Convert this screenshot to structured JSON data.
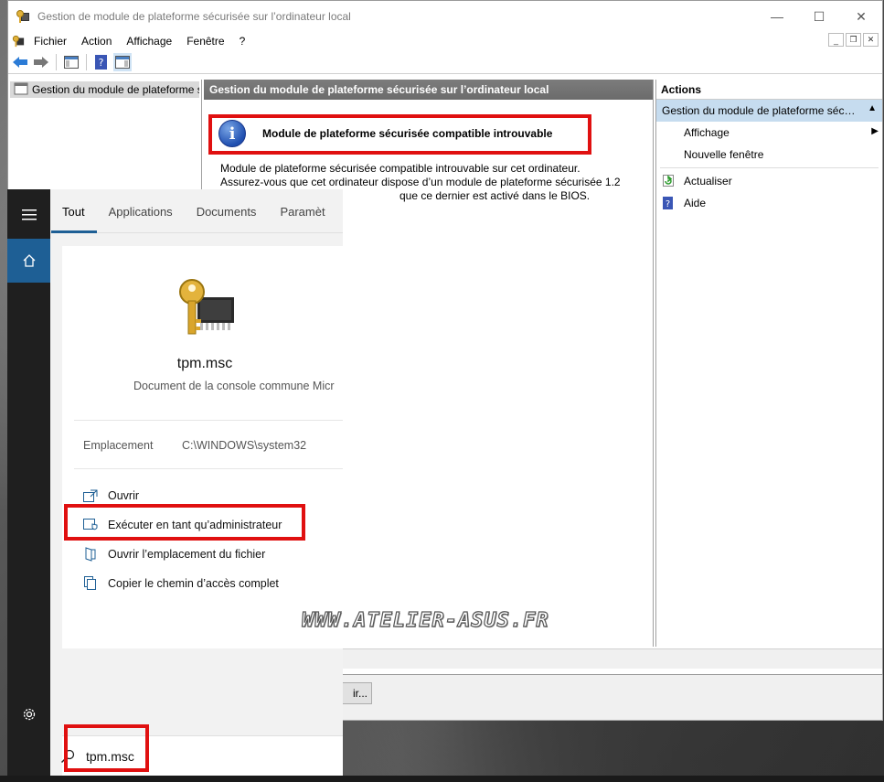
{
  "window": {
    "title": "Gestion de module de plateforme sécurisée sur l’ordinateur local",
    "controls": {
      "minimize": "—",
      "maximize": "☐",
      "close": "✕"
    }
  },
  "menu": {
    "items": [
      "Fichier",
      "Action",
      "Affichage",
      "Fenêtre",
      "?"
    ]
  },
  "tree": {
    "root_label": "Gestion du module de plateforme sécurisée"
  },
  "center": {
    "header": "Gestion du module de plateforme sécurisée sur l’ordinateur local",
    "tpm_heading": "Module de plateforme sécurisée compatible introuvable",
    "tpm_desc_line1": "Module de plateforme sécurisée compatible introuvable sur cet ordinateur.",
    "tpm_desc_line2": "Assurez-vous que cet ordinateur dispose d’un module de plateforme sécurisée 1.2",
    "tpm_desc_line3": "que ce dernier est activé dans le BIOS."
  },
  "actions": {
    "title": "Actions",
    "section": "Gestion du module de plateforme sécurisée",
    "items": [
      {
        "label": "Affichage",
        "icon": "none",
        "submenu": true
      },
      {
        "label": "Nouvelle fenêtre",
        "icon": "none",
        "submenu": false
      },
      {
        "label": "Actualiser",
        "icon": "refresh-icon",
        "submenu": false
      },
      {
        "label": "Aide",
        "icon": "help-icon",
        "submenu": false
      }
    ]
  },
  "dialog": {
    "button_label": "ir..."
  },
  "start": {
    "tabs": [
      "Tout",
      "Applications",
      "Documents",
      "Paramèt"
    ],
    "active_tab": "Tout",
    "result": {
      "name": "tpm.msc",
      "type": "Document de la console commune Micr",
      "location_label": "Emplacement",
      "location_value": "C:\\WINDOWS\\system32"
    },
    "context_actions": [
      {
        "label": "Ouvrir",
        "icon": "open-icon"
      },
      {
        "label": "Exécuter en tant qu’administrateur",
        "icon": "shield-icon"
      },
      {
        "label": "Ouvrir l’emplacement du fichier",
        "icon": "folder-icon"
      },
      {
        "label": "Copier le chemin d’accès complet",
        "icon": "copy-icon"
      }
    ],
    "search": {
      "value": "tpm.msc"
    }
  },
  "watermark": "WWW.ATELIER-ASUS.FR",
  "colors": {
    "accent": "#1e5f95",
    "annotation": "#e01010",
    "actions_highlight": "#c6dcef"
  }
}
